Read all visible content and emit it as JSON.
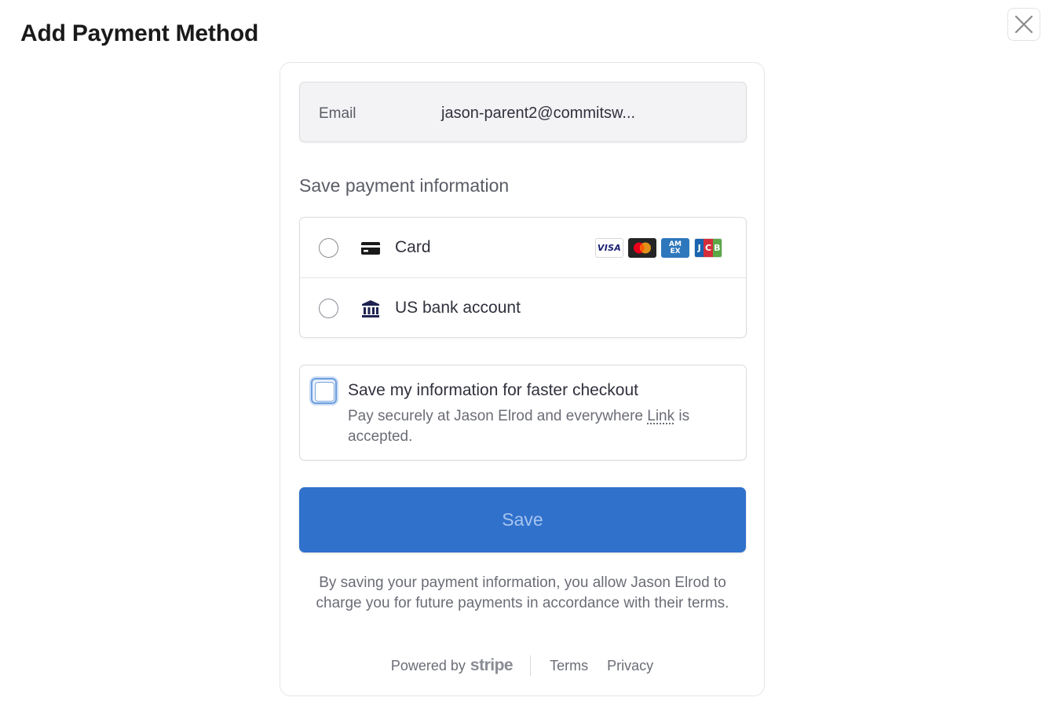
{
  "page": {
    "title": "Add Payment Method",
    "close_icon": "close-icon"
  },
  "email": {
    "label": "Email",
    "value": "jason-parent2@commitsw..."
  },
  "payment": {
    "heading": "Save payment information",
    "methods": [
      {
        "label": "Card",
        "icon": "card-icon",
        "selected": false
      },
      {
        "label": "US bank account",
        "icon": "bank-icon",
        "selected": false
      }
    ],
    "brands": [
      {
        "name": "VISA",
        "icon": "visa-icon"
      },
      {
        "name": "Mastercard",
        "icon": "mastercard-icon"
      },
      {
        "name": "AMEX",
        "icon": "amex-icon"
      },
      {
        "name": "JCB",
        "icon": "jcb-icon"
      }
    ]
  },
  "link": {
    "title": "Save my information for faster checkout",
    "desc_before": "Pay securely at Jason Elrod and everywhere ",
    "link_word": "Link",
    "desc_after": " is accepted.",
    "checked": false
  },
  "save_button": {
    "label": "Save"
  },
  "disclaimer": "By saving your payment information, you allow Jason Elrod to charge you for future payments in accordance with their terms.",
  "footer": {
    "powered_by": "Powered by",
    "brand": "stripe",
    "terms": "Terms",
    "privacy": "Privacy"
  },
  "colors": {
    "accent": "#3071cc",
    "button_text": "#a6c4ee",
    "text": "#30313d",
    "muted": "#6b6d76"
  }
}
